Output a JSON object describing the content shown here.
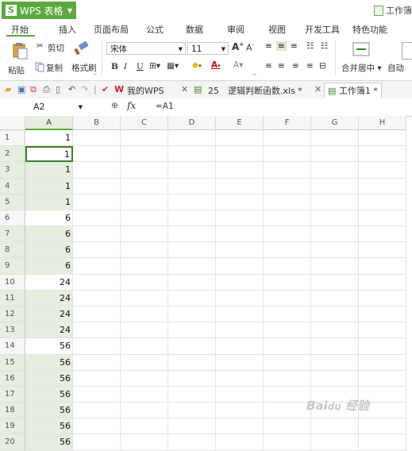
{
  "titlebar": {
    "app_label": "WPS 表格",
    "doc_label": "工作簿"
  },
  "menu": {
    "items": [
      "开始",
      "插入",
      "页面布局",
      "公式",
      "数据",
      "审阅",
      "视图",
      "开发工具",
      "特色功能"
    ]
  },
  "ribbon": {
    "paste": "粘贴",
    "cut": "剪切",
    "copy": "复制",
    "format_painter": "格式刷",
    "font_name": "宋体",
    "font_size": "11",
    "bold": "B",
    "italic": "I",
    "underline": "U",
    "merge_center": "合并居中",
    "auto_wrap": "自动"
  },
  "tabs": {
    "items": [
      "我的WPS",
      "25　逻辑判断函数.xls *",
      "工作簿1 *"
    ]
  },
  "formula_bar": {
    "name_box": "A2",
    "fx": "fx",
    "formula": "=A1"
  },
  "sheet": {
    "columns": [
      "A",
      "B",
      "C",
      "D",
      "E",
      "F",
      "G",
      "H"
    ],
    "rows": [
      "1",
      "2",
      "3",
      "4",
      "5",
      "6",
      "7",
      "8",
      "9",
      "10",
      "11",
      "12",
      "13",
      "14",
      "15",
      "16",
      "17",
      "18",
      "19",
      "20"
    ],
    "col_a_values": [
      "1",
      "1",
      "1",
      "1",
      "1",
      "6",
      "6",
      "6",
      "6",
      "24",
      "24",
      "24",
      "24",
      "56",
      "56",
      "56",
      "56",
      "56",
      "56",
      "56"
    ],
    "selected_rows": [
      2,
      3,
      4,
      5,
      7,
      8,
      9,
      11,
      12,
      13,
      15,
      16,
      17,
      18,
      19,
      20
    ],
    "active_cell_row": 2
  },
  "colors": {
    "accent": "#5bab3c",
    "selection": "#e6eedf"
  }
}
